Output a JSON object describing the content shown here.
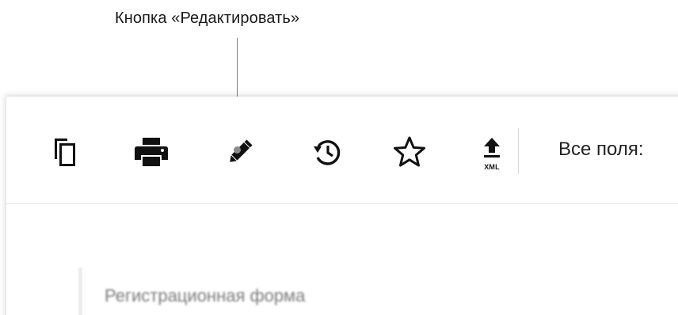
{
  "callout": {
    "label": "Кнопка «Редактировать»"
  },
  "toolbar": {
    "buttons": [
      {
        "icon": "copy-icon"
      },
      {
        "icon": "print-icon"
      },
      {
        "icon": "pencil-icon"
      },
      {
        "icon": "history-icon"
      },
      {
        "icon": "star-icon"
      },
      {
        "icon": "upload-xml-icon",
        "caption": "XML"
      }
    ],
    "fields_label": "Все поля:"
  },
  "form": {
    "title": "Регистрационная форма"
  },
  "colors": {
    "icon": "#111111",
    "separator": "#d9d9d9",
    "callout_line": "#7a7a7a"
  }
}
